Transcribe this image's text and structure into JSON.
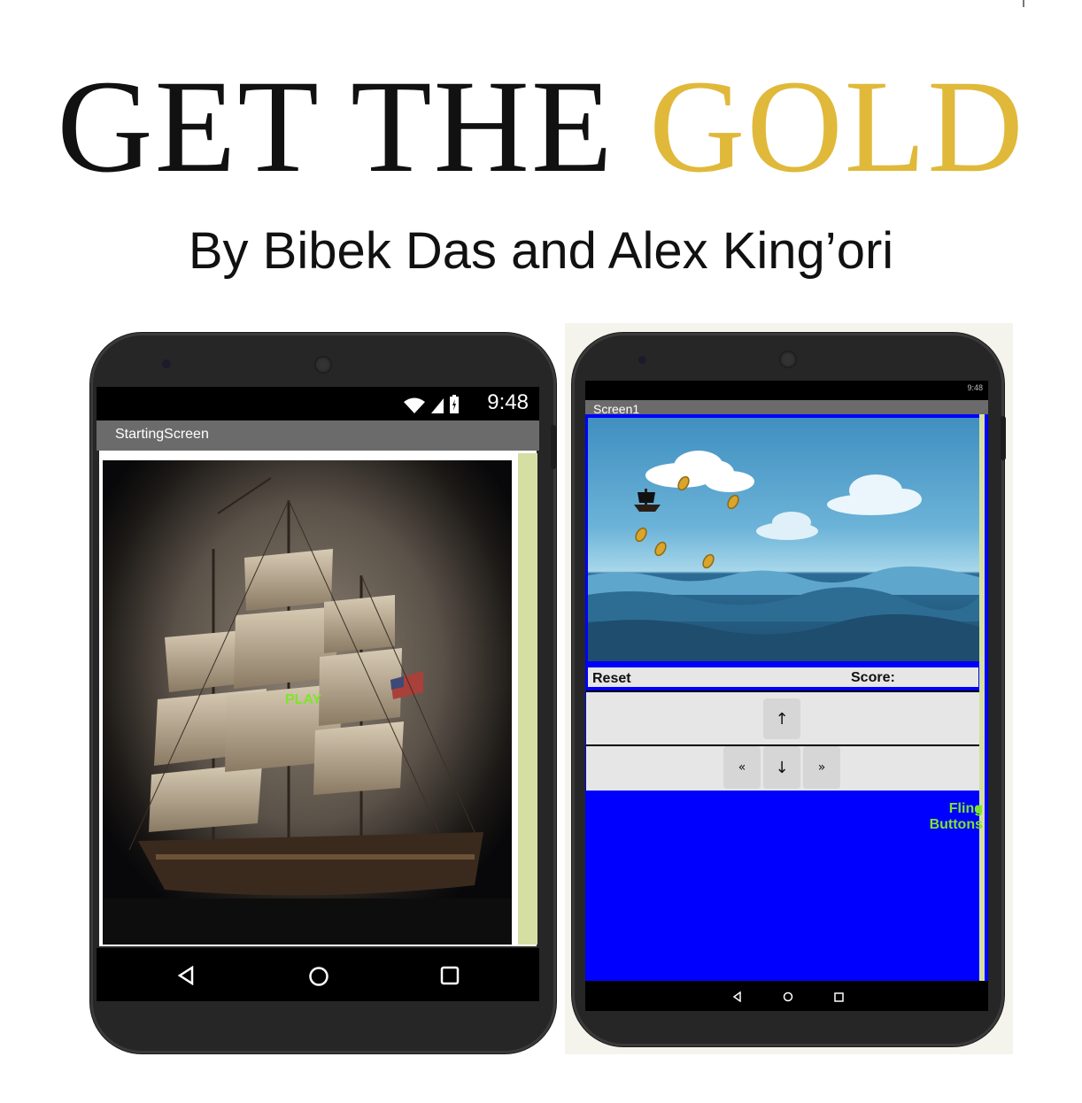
{
  "poster": {
    "title_word1": "GET THE",
    "title_word2": "GOLD",
    "byline": "By Bibek Das and Alex King’ori",
    "accent_color": "#e0b93a"
  },
  "phone_left": {
    "status_time": "9:48",
    "status_icons": [
      "wifi-icon",
      "signal-icon",
      "battery-icon"
    ],
    "title_bar": "StartingScreen",
    "play_label": "PLAY",
    "play_color": "#7fe52a",
    "nav_icons": [
      "back-icon",
      "home-icon",
      "recents-icon"
    ]
  },
  "phone_right": {
    "status_time": "9:48",
    "title_bar": "Screen1",
    "reset_label": "Reset",
    "score_label": "Score:",
    "up_label": "↑",
    "down_label": "↓",
    "left_label": "«",
    "right_label": "»",
    "fling_line1": "Fling",
    "fling_line2": "Buttons",
    "screen_color": "#0000ff",
    "nav_icons": [
      "back-icon",
      "home-icon",
      "recents-icon"
    ]
  }
}
